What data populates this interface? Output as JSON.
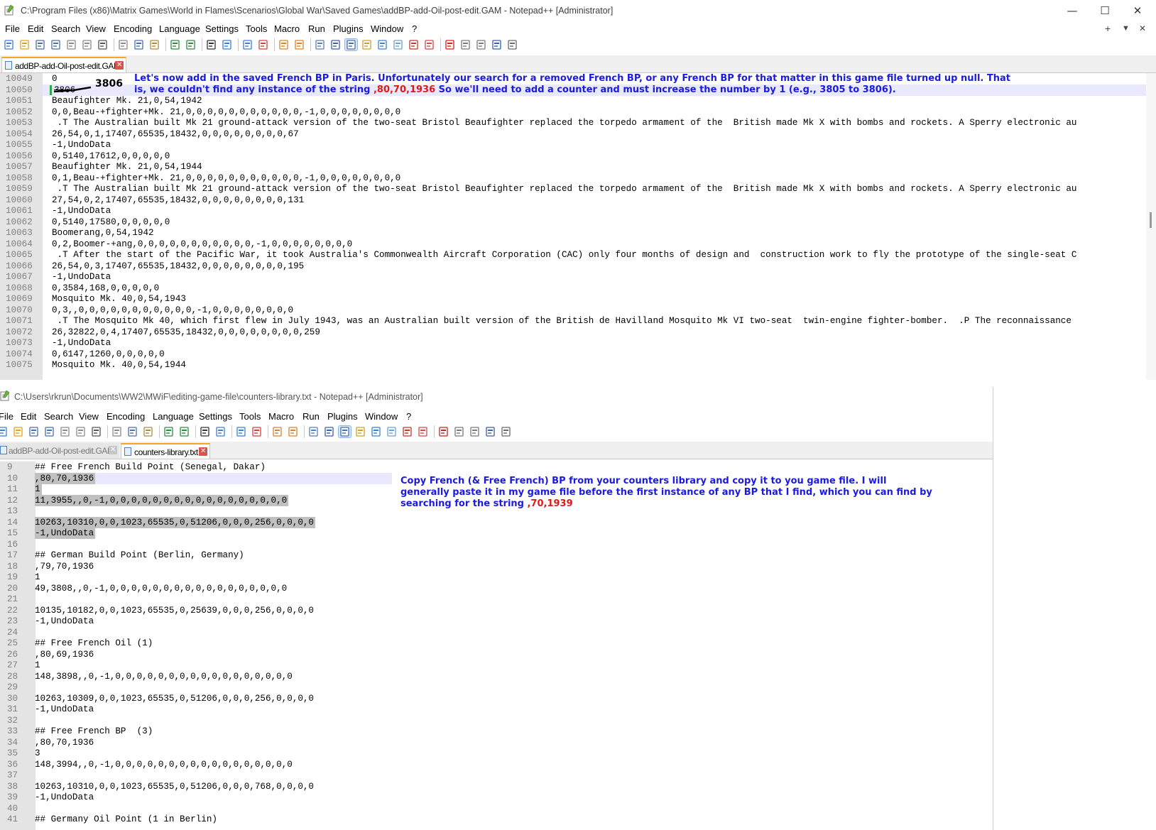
{
  "window1": {
    "title": "C:\\Program Files (x86)\\Matrix Games\\World in Flames\\Scenarios\\Global War\\Saved Games\\addBP-add-Oil-post-edit.GAM - Notepad++ [Administrator]",
    "controls": {
      "minimize": "—",
      "maximize": "☐",
      "close": "✕"
    },
    "menu": [
      "File",
      "Edit",
      "Search",
      "View",
      "Encoding",
      "Language",
      "Settings",
      "Tools",
      "Macro",
      "Run",
      "Plugins",
      "Window",
      "?"
    ],
    "menu_right": {
      "add": "+",
      "dropdown": "▼",
      "close": "✕"
    },
    "tab": {
      "label": "addBP-add-Oil-post-edit.GAM",
      "close": "✕"
    },
    "overwritten_value": "3806",
    "correction": "3806",
    "lines": [
      {
        "n": "10049",
        "text": "0"
      },
      {
        "n": "10050",
        "text": ""
      },
      {
        "n": "10051",
        "text": "Beaufighter Mk. 21,0,54,1942"
      },
      {
        "n": "10052",
        "text": "0,0,Beau-+fighter+Mk. 21,0,0,0,0,0,0,0,0,0,0,0,-1,0,0,0,0,0,0,0,0"
      },
      {
        "n": "10053",
        "text": " .T The Australian built Mk 21 ground-attack version of the two-seat Bristol Beaufighter replaced the torpedo armament of the  British made Mk X with bombs and rockets. A Sperry electronic au"
      },
      {
        "n": "10054",
        "text": "26,54,0,1,17407,65535,18432,0,0,0,0,0,0,0,0,67"
      },
      {
        "n": "10055",
        "text": "-1,UndoData"
      },
      {
        "n": "10056",
        "text": "0,5140,17612,0,0,0,0,0"
      },
      {
        "n": "10057",
        "text": "Beaufighter Mk. 21,0,54,1944"
      },
      {
        "n": "10058",
        "text": "0,1,Beau-+fighter+Mk. 21,0,0,0,0,0,0,0,0,0,0,0,-1,0,0,0,0,0,0,0,0"
      },
      {
        "n": "10059",
        "text": " .T The Australian built Mk 21 ground-attack version of the two-seat Bristol Beaufighter replaced the torpedo armament of the  British made Mk X with bombs and rockets. A Sperry electronic au"
      },
      {
        "n": "10060",
        "text": "27,54,0,2,17407,65535,18432,0,0,0,0,0,0,0,0,131"
      },
      {
        "n": "10061",
        "text": "-1,UndoData"
      },
      {
        "n": "10062",
        "text": "0,5140,17580,0,0,0,0,0"
      },
      {
        "n": "10063",
        "text": "Boomerang,0,54,1942"
      },
      {
        "n": "10064",
        "text": "0,2,Boomer-+ang,0,0,0,0,0,0,0,0,0,0,0,-1,0,0,0,0,0,0,0,0"
      },
      {
        "n": "10065",
        "text": " .T After the start of the Pacific War, it took Australia's Commonwealth Aircraft Corporation (CAC) only four months of design and  construction work to fly the prototype of the single-seat C"
      },
      {
        "n": "10066",
        "text": "26,54,0,3,17407,65535,18432,0,0,0,0,0,0,0,0,195"
      },
      {
        "n": "10067",
        "text": "-1,UndoData"
      },
      {
        "n": "10068",
        "text": "0,3584,168,0,0,0,0,0"
      },
      {
        "n": "10069",
        "text": "Mosquito Mk. 40,0,54,1943"
      },
      {
        "n": "10070",
        "text": "0,3,,0,0,0,0,0,0,0,0,0,0,0,-1,0,0,0,0,0,0,0,0"
      },
      {
        "n": "10071",
        "text": " .T The Mosquito Mk 40, which first flew in July 1943, was an Australian built version of the British de Havilland Mosquito Mk VI two-seat  twin-engine fighter-bomber.  .P The reconnaissance"
      },
      {
        "n": "10072",
        "text": "26,32822,0,4,17407,65535,18432,0,0,0,0,0,0,0,0,259"
      },
      {
        "n": "10073",
        "text": "-1,UndoData"
      },
      {
        "n": "10074",
        "text": "0,6147,1260,0,0,0,0,0"
      },
      {
        "n": "10075",
        "text": "Mosquito Mk. 40,0,54,1944"
      }
    ],
    "note": {
      "line1": "Let's now add in the saved French BP in Paris.  Unfortunately our search for a removed French BP, or any French BP for that matter in this game file turned up null.  That",
      "line2a": "is, we couldn't find any instance of the string ",
      "line2_red": ",80,70,1936",
      "line2b": "    So we'll need to add a counter and must increase the number by 1 (e.g., 3805 to 3806)."
    }
  },
  "window2": {
    "title": "C:\\Users\\rkrun\\Documents\\WW2\\MWiF\\editing-game-file\\counters-library.txt - Notepad++ [Administrator]",
    "menu": [
      "File",
      "Edit",
      "Search",
      "View",
      "Encoding",
      "Language",
      "Settings",
      "Tools",
      "Macro",
      "Run",
      "Plugins",
      "Window",
      "?"
    ],
    "tabs": [
      {
        "label": "addBP-add-Oil-post-edit.GAM",
        "close": "✕"
      },
      {
        "label": "counters-library.txt",
        "close": "✕"
      }
    ],
    "lines": [
      {
        "n": "9",
        "text": "## Free French Build Point (Senegal, Dakar)"
      },
      {
        "n": "10",
        "text": ",80,70,1936"
      },
      {
        "n": "11",
        "text": "1"
      },
      {
        "n": "12",
        "text": "11,3955,,0,-1,0,0,0,0,0,0,0,0,0,0,0,0,0,0,0,0,0"
      },
      {
        "n": "13",
        "text": ""
      },
      {
        "n": "14",
        "text": "10263,10310,0,0,1023,65535,0,51206,0,0,0,256,0,0,0,0"
      },
      {
        "n": "15",
        "text": "-1,UndoData"
      },
      {
        "n": "16",
        "text": ""
      },
      {
        "n": "17",
        "text": "## German Build Point (Berlin, Germany)"
      },
      {
        "n": "18",
        "text": ",79,70,1936"
      },
      {
        "n": "19",
        "text": "1"
      },
      {
        "n": "20",
        "text": "49,3808,,0,-1,0,0,0,0,0,0,0,0,0,0,0,0,0,0,0,0,0"
      },
      {
        "n": "21",
        "text": ""
      },
      {
        "n": "22",
        "text": "10135,10182,0,0,1023,65535,0,25639,0,0,0,256,0,0,0,0"
      },
      {
        "n": "23",
        "text": "-1,UndoData"
      },
      {
        "n": "24",
        "text": ""
      },
      {
        "n": "25",
        "text": "## Free French Oil (1)"
      },
      {
        "n": "26",
        "text": ",80,69,1936"
      },
      {
        "n": "27",
        "text": "1"
      },
      {
        "n": "28",
        "text": "148,3898,,0,-1,0,0,0,0,0,0,0,0,0,0,0,0,0,0,0,0,0"
      },
      {
        "n": "29",
        "text": ""
      },
      {
        "n": "30",
        "text": "10263,10309,0,0,1023,65535,0,51206,0,0,0,256,0,0,0,0"
      },
      {
        "n": "31",
        "text": "-1,UndoData"
      },
      {
        "n": "32",
        "text": ""
      },
      {
        "n": "33",
        "text": "## Free French BP  (3)"
      },
      {
        "n": "34",
        "text": ",80,70,1936"
      },
      {
        "n": "35",
        "text": "3"
      },
      {
        "n": "36",
        "text": "148,3994,,0,-1,0,0,0,0,0,0,0,0,0,0,0,0,0,0,0,0,0"
      },
      {
        "n": "37",
        "text": ""
      },
      {
        "n": "38",
        "text": "10263,10310,0,0,1023,65535,0,51206,0,0,0,768,0,0,0,0"
      },
      {
        "n": "39",
        "text": "-1,UndoData"
      },
      {
        "n": "40",
        "text": ""
      },
      {
        "n": "41",
        "text": "## Germany Oil Point (1 in Berlin)"
      }
    ],
    "note": {
      "line1": "Copy French (& Free French) BP from your counters library and copy it to you game file.  I will",
      "line2": "generally paste it in my game file before the first instance of any BP that I find, which you can find by",
      "line3a": "searching for the string  ",
      "line3_red": ",70,1939"
    }
  },
  "colors": {
    "annotation_blue": "#1a1ae0",
    "annotation_red": "#e01818",
    "gutter": "#e4e4e4",
    "selection": "#c0c0c0",
    "current_line": "#e8e8ff",
    "active_tab_accent": "#f5a623",
    "tab_close_red": "#d9534f"
  },
  "toolbar_icons": [
    "new-file-icon",
    "open-file-icon",
    "save-icon",
    "save-all-icon",
    "close-icon",
    "close-all-icon",
    "print-icon",
    "cut-icon",
    "copy-icon",
    "paste-icon",
    "undo-icon",
    "redo-icon",
    "find-icon",
    "replace-icon",
    "zoom-in-icon",
    "zoom-out-icon",
    "sync-vertical-icon",
    "sync-horizontal-icon",
    "word-wrap-icon",
    "show-all-chars-icon",
    "indent-guide-icon",
    "udl-icon",
    "doc-map-icon",
    "function-list-icon",
    "folder-workspace-icon",
    "monitoring-icon",
    "record-macro-icon",
    "stop-record-icon",
    "play-macro-icon",
    "run-macro-multiple-icon",
    "save-macro-icon"
  ]
}
